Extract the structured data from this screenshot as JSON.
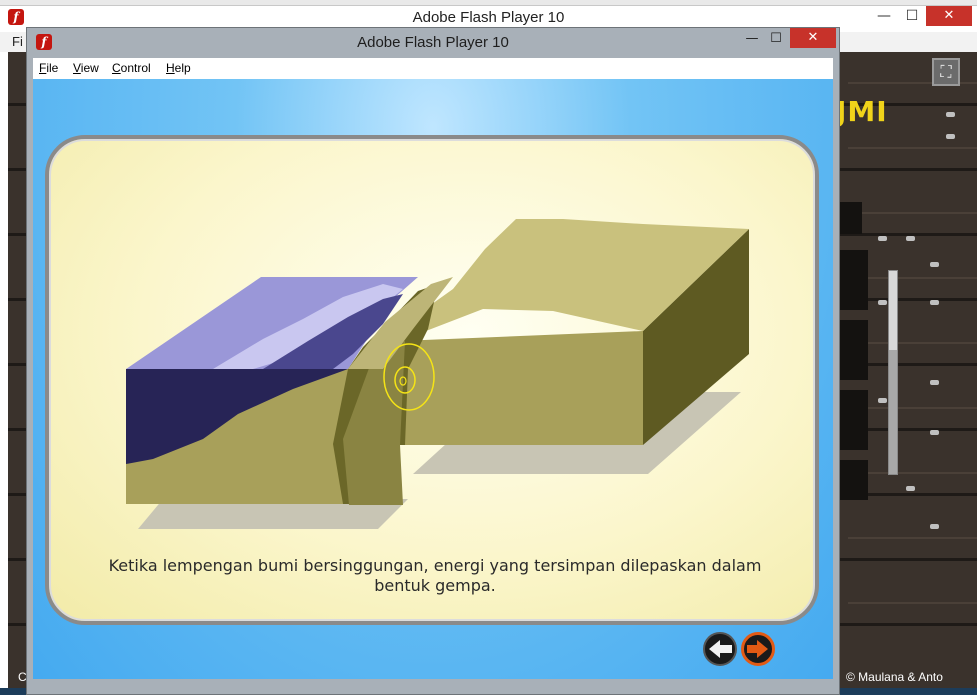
{
  "background_window": {
    "title": "Adobe Flash Player 10",
    "menu_first_fragment": "Fi",
    "heading_fragment": "JMI",
    "copyright": "© Maulana & Anto",
    "left_bottom_fragment": "C",
    "controls": {
      "minimize": "—",
      "maximize": "☐",
      "close": "✕",
      "fullscreen": "⛶"
    }
  },
  "window": {
    "title": "Adobe Flash Player 10",
    "controls": {
      "minimize": "—",
      "maximize": "☐",
      "close": "✕"
    },
    "menu": [
      {
        "label": "File",
        "accel": "F",
        "rest": "ile"
      },
      {
        "label": "View",
        "accel": "V",
        "rest": "iew"
      },
      {
        "label": "Control",
        "accel": "C",
        "rest": "ontrol"
      },
      {
        "label": "Help",
        "accel": "H",
        "rest": "elp"
      }
    ]
  },
  "slide": {
    "caption_line1": "Ketika lempengan bumi bersinggungan, energi yang tersimpan dilepaskan dalam",
    "caption_line2": "bentuk gempa.",
    "nav": {
      "back_icon": "arrow-left-icon",
      "next_icon": "arrow-right-icon"
    }
  },
  "colors": {
    "stage_blue": "#45aaf0",
    "card_cream": "#fbf6cc",
    "earth_top": "#c8c07c",
    "earth_front": "#a8a058",
    "earth_side": "#5e5a22",
    "ocean": "#9a97d8",
    "ocean_deep": "#272456",
    "quake_ring": "#f5e416",
    "next_ring": "#e25a14",
    "close_red": "#c7322a"
  }
}
